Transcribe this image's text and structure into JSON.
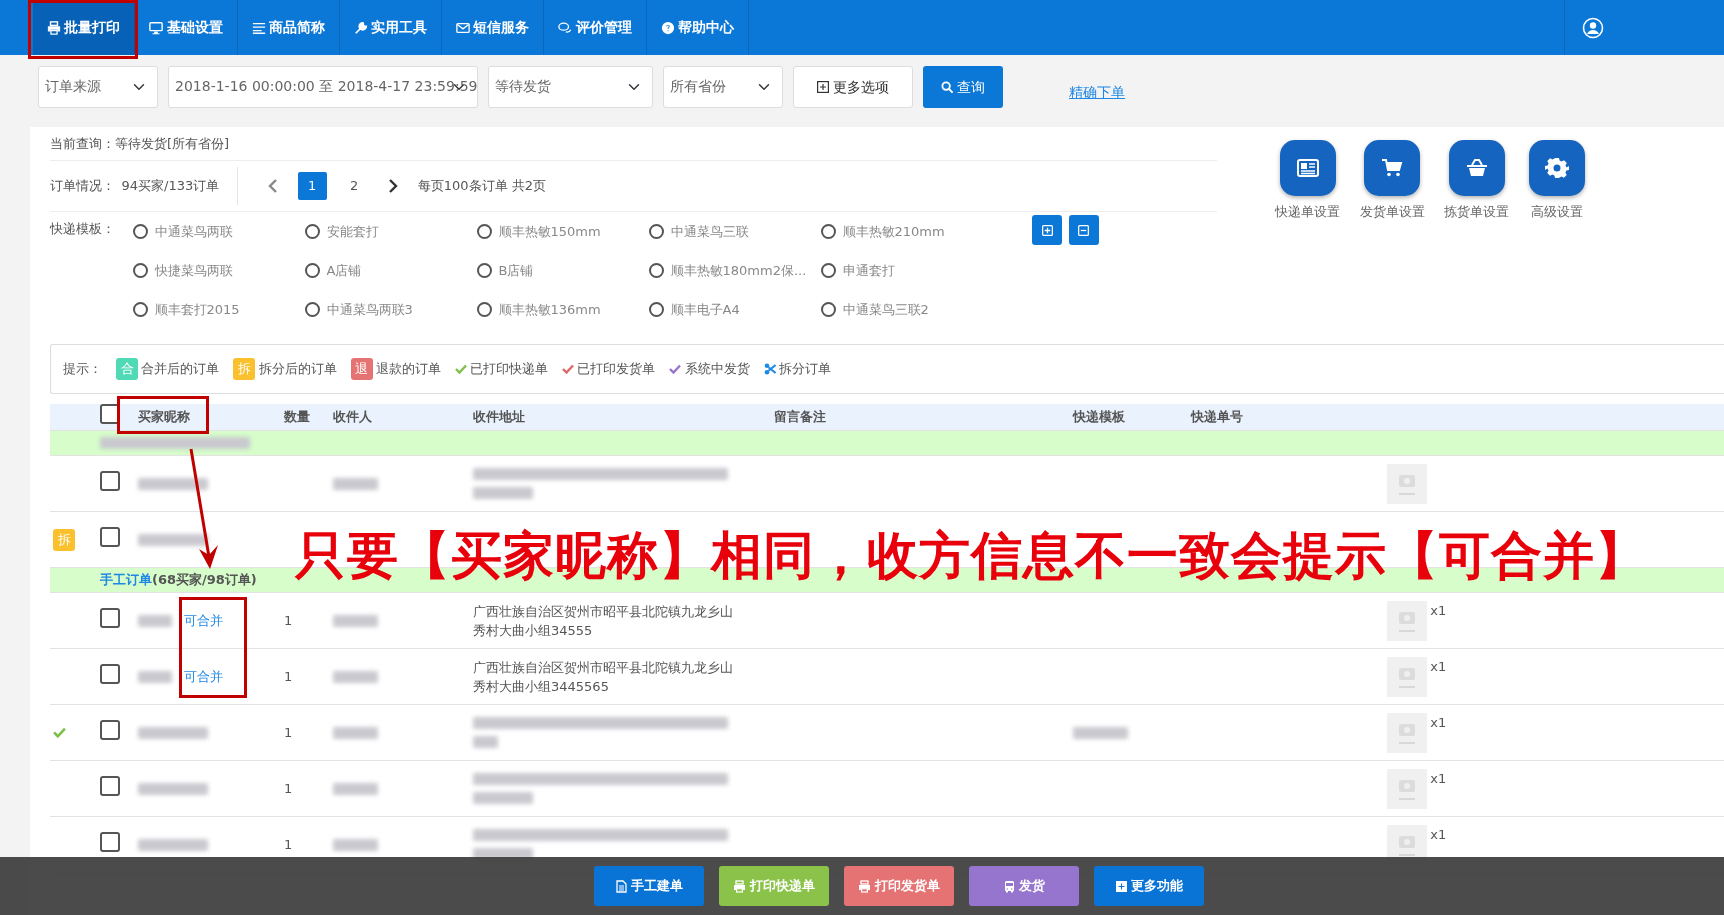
{
  "nav": {
    "items": [
      {
        "label": "批量打印",
        "selected": true
      },
      {
        "label": "基础设置",
        "selected": false
      },
      {
        "label": "商品简称",
        "selected": false
      },
      {
        "label": "实用工具",
        "selected": false
      },
      {
        "label": "短信服务",
        "selected": false
      },
      {
        "label": "评价管理",
        "selected": false
      },
      {
        "label": "帮助中心",
        "selected": false
      }
    ]
  },
  "filters": {
    "source": {
      "value": "订单来源"
    },
    "date_range": {
      "value": "2018-1-16 00:00:00 至 2018-4-17 23:59:59"
    },
    "status": {
      "value": "等待发货"
    },
    "province": {
      "value": "所有省份"
    },
    "more_button": "更多选项",
    "search_button": "查询",
    "exact_link": "精确下单"
  },
  "query": {
    "text": "当前查询：等待发货[所有省份]"
  },
  "orders_summary": {
    "label": "订单情况：",
    "value": "94买家/133订单"
  },
  "pagination": {
    "pages": [
      {
        "label": "1",
        "selected": true
      },
      {
        "label": "2",
        "selected": false
      }
    ],
    "summary": "每页100条订单 共2页"
  },
  "templates": {
    "label": "快递模板：",
    "options": [
      {
        "label": "中通菜鸟两联",
        "selected": false
      },
      {
        "label": "安能套打",
        "selected": false
      },
      {
        "label": "顺丰热敏150mm",
        "selected": false
      },
      {
        "label": "中通菜鸟三联",
        "selected": false
      },
      {
        "label": "顺丰热敏210mm",
        "selected": false
      },
      {
        "label": "快捷菜鸟两联",
        "selected": false
      },
      {
        "label": "A店铺",
        "selected": false
      },
      {
        "label": "B店铺",
        "selected": false
      },
      {
        "label": "顺丰热敏180mm2保...",
        "selected": false
      },
      {
        "label": "申通套打",
        "selected": false
      },
      {
        "label": "顺丰套打2015",
        "selected": false
      },
      {
        "label": "中通菜鸟两联3",
        "selected": false
      },
      {
        "label": "顺丰热敏136mm",
        "selected": false
      },
      {
        "label": "顺丰电子A4",
        "selected": false
      },
      {
        "label": "中通菜鸟三联2",
        "selected": false
      }
    ]
  },
  "settings": [
    {
      "label": "快递单设置"
    },
    {
      "label": "发货单设置"
    },
    {
      "label": "拣货单设置"
    },
    {
      "label": "高级设置"
    }
  ],
  "hints": {
    "label": "提示：",
    "items": [
      {
        "kind": "badge",
        "badge": "合",
        "label": "合并后的订单",
        "color": "#4fd9b4"
      },
      {
        "kind": "badge",
        "badge": "拆",
        "label": "拆分后的订单",
        "color": "#fbc02d"
      },
      {
        "kind": "badge",
        "badge": "退",
        "label": "退款的订单",
        "color": "#e57373"
      },
      {
        "kind": "check",
        "label": "已打印快递单",
        "color": "#7cc04a"
      },
      {
        "kind": "check",
        "label": "已打印发货单",
        "color": "#e06666"
      },
      {
        "kind": "check",
        "label": "系统中发货",
        "color": "#9575cd"
      },
      {
        "kind": "scissors",
        "label": "拆分订单",
        "color": "#1e88e5"
      }
    ]
  },
  "table": {
    "select_all": {
      "checked": false
    },
    "columns": [
      "买家昵称",
      "数量",
      "收件人",
      "收件地址",
      "留言备注",
      "快递模板",
      "快递单号"
    ],
    "rows": [
      {
        "kind": "group"
      },
      {
        "kind": "order",
        "checked": false,
        "printed": false
      },
      {
        "kind": "order",
        "badge": "拆",
        "checked": false,
        "printed": false
      },
      {
        "kind": "group",
        "title": "手工订单",
        "count": "(68买家/98订单)"
      },
      {
        "kind": "order",
        "checked": false,
        "printed": false,
        "merge_link": "可合并",
        "quantity": "1",
        "address": "广西壮族自治区贺州市昭平县北陀镇九龙乡山秀村大曲小组34555",
        "item_count": "x1"
      },
      {
        "kind": "order",
        "checked": false,
        "printed": false,
        "merge_link": "可合并",
        "quantity": "1",
        "address": "广西壮族自治区贺州市昭平县北陀镇九龙乡山秀村大曲小组3445565",
        "item_count": "x1"
      },
      {
        "kind": "order",
        "checked": false,
        "printed": true,
        "quantity": "1",
        "item_count": "x1"
      },
      {
        "kind": "order",
        "checked": false,
        "printed": false,
        "quantity": "1",
        "item_count": "x1"
      },
      {
        "kind": "order",
        "checked": false,
        "printed": false,
        "quantity": "1",
        "item_count": "x1"
      }
    ]
  },
  "action_bar": {
    "buttons": [
      {
        "label": "手工建单",
        "color": "#0a73d6"
      },
      {
        "label": "打印快递单",
        "color": "#8bc34a"
      },
      {
        "label": "打印发货单",
        "color": "#e57373"
      },
      {
        "label": "发货",
        "color": "#9575cd"
      },
      {
        "label": "更多功能",
        "color": "#0a73d6"
      }
    ]
  },
  "annotation": {
    "text": "只要【买家昵称】相同，收方信息不一致会提示【可合并】"
  }
}
